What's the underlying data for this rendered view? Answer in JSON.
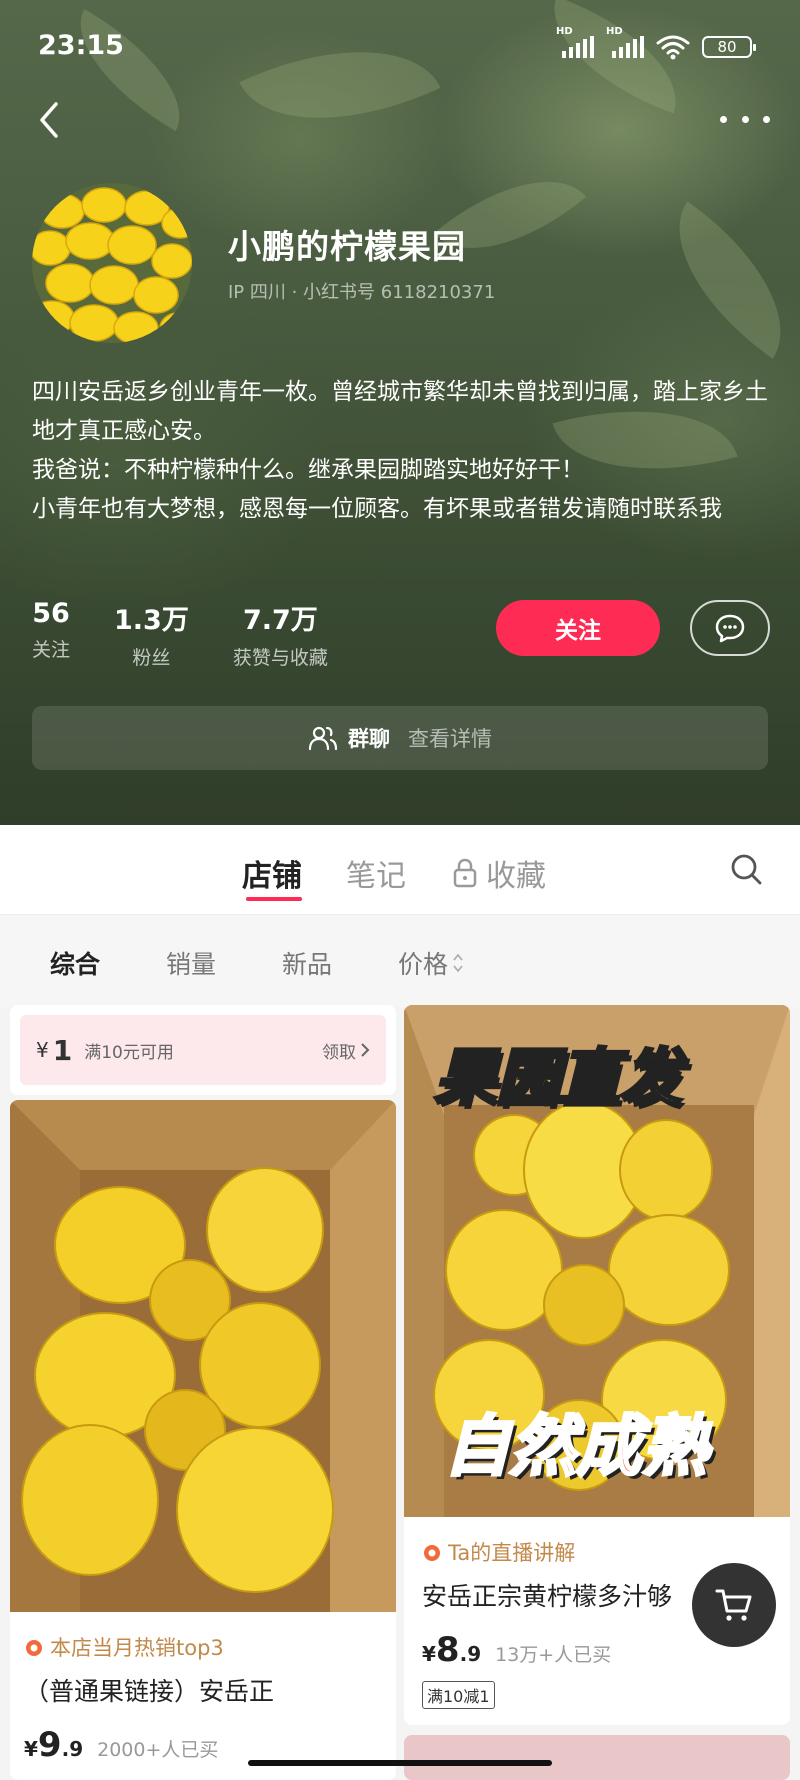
{
  "status_bar": {
    "time": "23:15",
    "network_1": "HD",
    "network_2": "HD",
    "battery": "80"
  },
  "profile": {
    "name": "小鹏的柠檬果园",
    "meta": "IP 四川 · 小红书号 6118210371",
    "bio_lines": [
      "四川安岳返乡创业青年一枚。曾经城市繁华却未曾找到归属，踏上家乡土地才真正感心安。",
      "我爸说：不种柠檬种什么。继承果园脚踏实地好好干！",
      "小青年也有大梦想，感恩每一位顾客。有坏果或者错发请随时联系我"
    ],
    "stats": [
      {
        "value": "56",
        "label": "关注"
      },
      {
        "value": "1.3万",
        "label": "粉丝"
      },
      {
        "value": "7.7万",
        "label": "获赞与收藏"
      }
    ],
    "follow_label": "关注",
    "group_chat": {
      "label": "群聊",
      "detail": "查看详情"
    }
  },
  "tabs": [
    {
      "label": "店铺",
      "active": true
    },
    {
      "label": "笔记",
      "active": false
    },
    {
      "label": "收藏",
      "active": false,
      "locked": true
    }
  ],
  "sort_options": [
    {
      "label": "综合",
      "active": true
    },
    {
      "label": "销量",
      "active": false
    },
    {
      "label": "新品",
      "active": false
    },
    {
      "label": "价格",
      "active": false,
      "sortable": true
    }
  ],
  "coupon": {
    "currency": "¥",
    "amount": "1",
    "condition": "满10元可用",
    "claim_label": "领取"
  },
  "products": [
    {
      "tag": "本店当月热销top3",
      "title": "（普通果链接）安岳正",
      "price_currency": "¥",
      "price_int": "9",
      "price_dec": ".9",
      "sold": "2000+人已买"
    },
    {
      "image_overlay_top": "果园直发",
      "image_overlay_bottom": "自然成熟",
      "tag": "Ta的直播讲解",
      "title": "安岳正宗黄柠檬多汁够",
      "price_currency": "¥",
      "price_int": "8",
      "price_dec": ".9",
      "sold": "13万+人已买",
      "promo": "满10减1"
    }
  ],
  "colors": {
    "accent": "#fe2c55",
    "tag": "#c28a4a"
  }
}
